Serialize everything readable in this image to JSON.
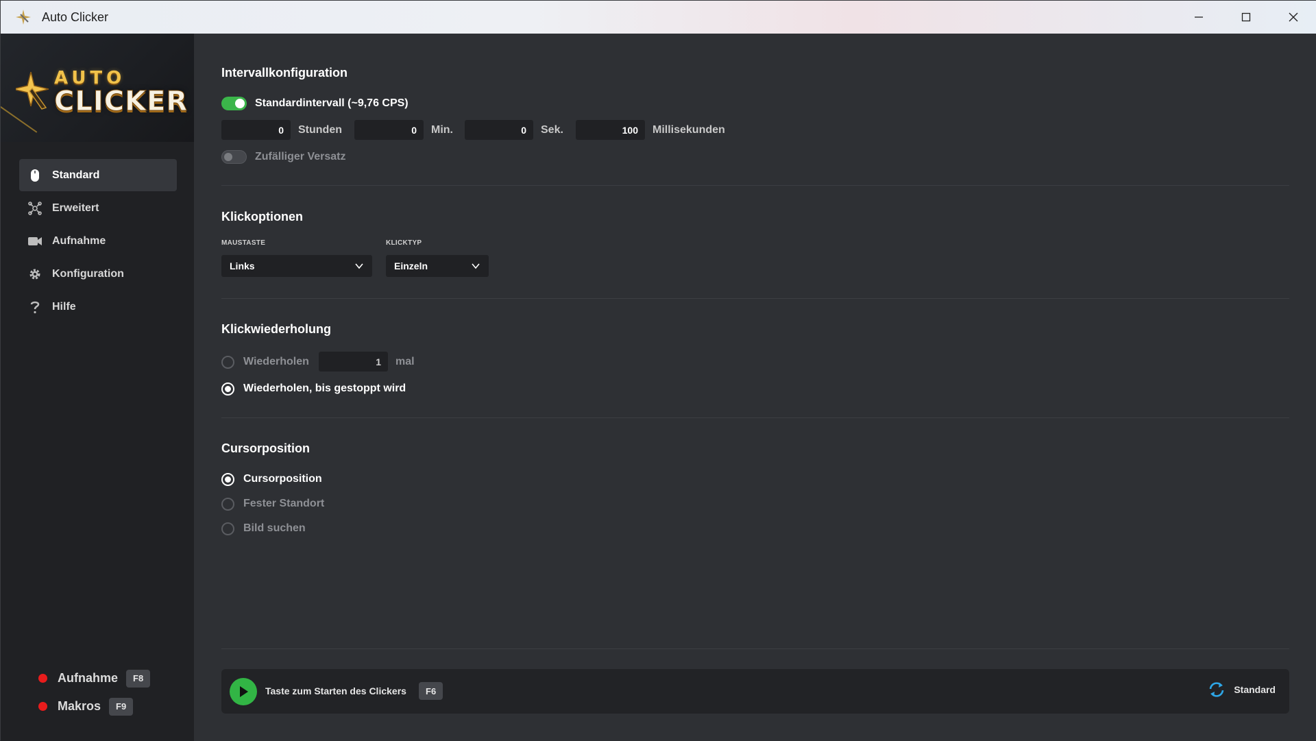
{
  "window": {
    "title": "Auto Clicker"
  },
  "logo": {
    "line1": "AUTO",
    "line2": "CLICKER"
  },
  "sidebar": {
    "items": [
      {
        "label": "Standard",
        "icon": "mouse-icon",
        "active": true
      },
      {
        "label": "Erweitert",
        "icon": "advanced-icon"
      },
      {
        "label": "Aufnahme",
        "icon": "camera-icon"
      },
      {
        "label": "Konfiguration",
        "icon": "gear-icon"
      },
      {
        "label": "Hilfe",
        "icon": "help-icon"
      }
    ],
    "hotkeys": [
      {
        "label": "Aufnahme",
        "key": "F8"
      },
      {
        "label": "Makros",
        "key": "F9"
      }
    ]
  },
  "interval": {
    "title": "Intervallkonfiguration",
    "standard_label": "Standardintervall (~9,76 CPS)",
    "hours": "0",
    "hours_unit": "Stunden",
    "minutes": "0",
    "minutes_unit": "Min.",
    "seconds": "0",
    "seconds_unit": "Sek.",
    "millis": "100",
    "millis_unit": "Millisekunden",
    "random_label": "Zufälliger Versatz"
  },
  "click_options": {
    "title": "Klickoptionen",
    "mouse_caption": "MAUSTASTE",
    "mouse_value": "Links",
    "type_caption": "KLICKTYP",
    "type_value": "Einzeln"
  },
  "repeat": {
    "title": "Klickwiederholung",
    "repeat_label": "Wiederholen",
    "repeat_count": "1",
    "repeat_unit": "mal",
    "until_stopped_label": "Wiederholen, bis gestoppt wird"
  },
  "cursor": {
    "title": "Cursorposition",
    "opt_current": "Cursorposition",
    "opt_fixed": "Fester Standort",
    "opt_image": "Bild suchen"
  },
  "footer": {
    "start_label": "Taste zum Starten des Clickers",
    "start_key": "F6",
    "reset_label": "Standard"
  },
  "colors": {
    "accent_green": "#3bb54a",
    "record_red": "#e81c1c"
  }
}
